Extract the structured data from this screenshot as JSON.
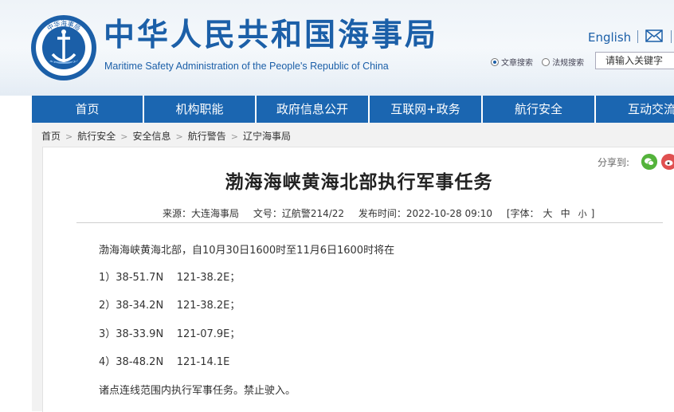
{
  "header": {
    "title": "中华人民共和国海事局",
    "subtitle": "Maritime Safety Administration of the People's Republic of China",
    "english_link": "English",
    "logo_text_top": "中华海事局",
    "logo_text_bottom": "CHINA MSA",
    "search": {
      "options": [
        "文章搜索",
        "法规搜索"
      ],
      "selected": "文章搜索",
      "placeholder": "请输入关键字"
    }
  },
  "nav": {
    "items": [
      "首页",
      "机构职能",
      "政府信息公开",
      "互联网+政务",
      "航行安全",
      "互动交流"
    ]
  },
  "breadcrumb": [
    "首页",
    "航行安全",
    "安全信息",
    "航行警告",
    "辽宁海事局"
  ],
  "share": {
    "label": "分享到:"
  },
  "article": {
    "title": "渤海海峡黄海北部执行军事任务",
    "meta": {
      "source": "来源：大连海事局",
      "doc_no": "文号：辽航警214/22",
      "publish_time": "发布时间：2022-10-28 09:10",
      "font_label": "[字体：",
      "font_sizes": [
        "大",
        "中",
        "小"
      ],
      "font_close": "]"
    },
    "paragraphs": [
      "渤海海峡黄海北部，自10月30日1600时至11月6日1600时将在",
      "1）38-51.7N    121-38.2E；",
      "2）38-34.2N    121-38.2E；",
      "3）38-33.9N    121-07.9E；",
      "4）38-48.2N    121-14.1E",
      "诸点连线范围内执行军事任务。禁止驶入。"
    ]
  },
  "colors": {
    "brand_blue": "#1b5fa8",
    "nav_blue": "#1b66b1",
    "wechat_green": "#54b33b",
    "weibo_red": "#e05050"
  }
}
